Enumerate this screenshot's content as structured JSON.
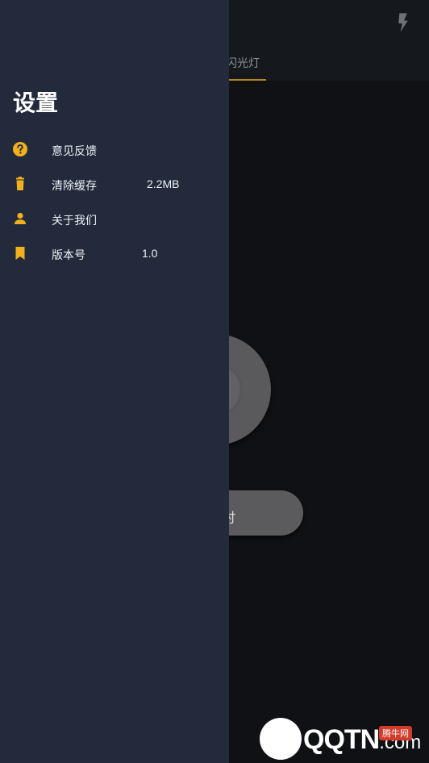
{
  "background_app": {
    "tab_label": "闪光灯",
    "timer_label": "定时",
    "accent_color": "#b58a1c"
  },
  "drawer": {
    "title": "设置",
    "icon_color": "#f2b01e",
    "items": [
      {
        "label": "意见反馈",
        "icon": "help-icon"
      },
      {
        "label": "清除缓存",
        "value": "2.2MB",
        "icon": "trash-icon"
      },
      {
        "label": "关于我们",
        "icon": "person-icon"
      },
      {
        "label": "版本号",
        "value": "1.0",
        "icon": "bookmark-icon"
      }
    ]
  },
  "watermark": {
    "brand": "QQTN",
    "suffix": ".com",
    "badge": "腾牛网"
  }
}
